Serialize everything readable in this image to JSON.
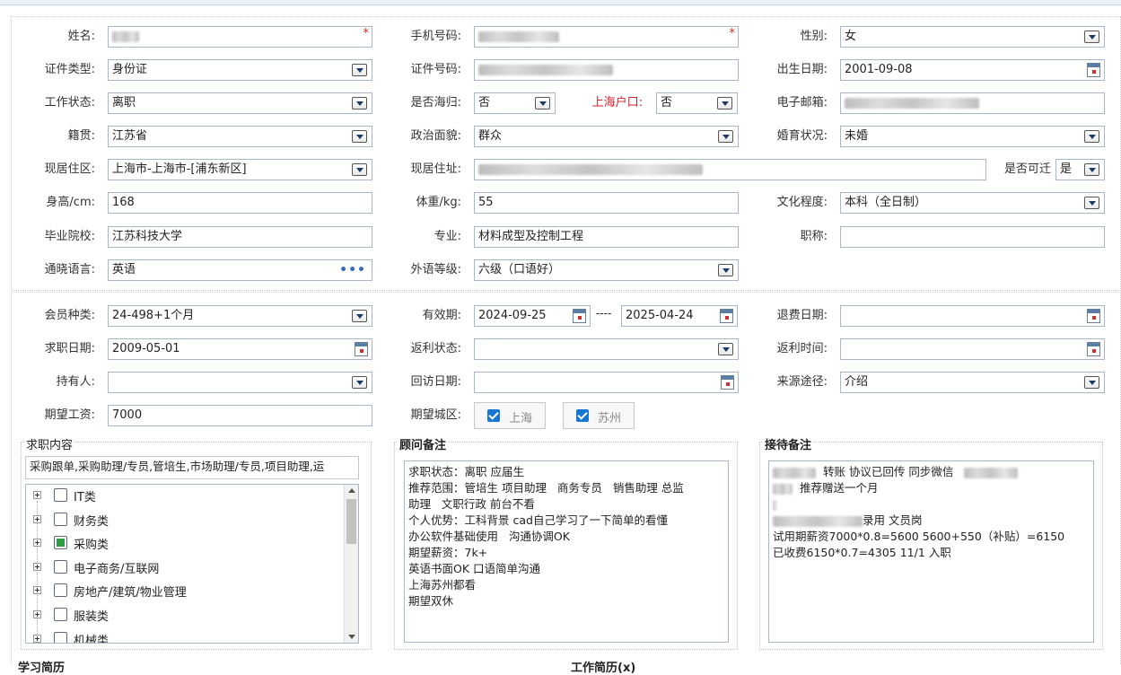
{
  "form": {
    "name": {
      "label": "姓名:",
      "req": "*"
    },
    "phone": {
      "label": "手机号码:",
      "req": "*"
    },
    "gender": {
      "label": "性别:",
      "value": "女"
    },
    "id_type": {
      "label": "证件类型:",
      "value": "身份证"
    },
    "id_no": {
      "label": "证件号码:"
    },
    "birth": {
      "label": "出生日期:",
      "value": "2001-09-08"
    },
    "work_status": {
      "label": "工作状态:",
      "value": "离职"
    },
    "overseas": {
      "label": "是否海归:",
      "value": "否"
    },
    "sh_hukou": {
      "label": "上海户口:",
      "value": "否"
    },
    "email": {
      "label": "电子邮箱:"
    },
    "native": {
      "label": "籍贯:",
      "value": "江苏省"
    },
    "political": {
      "label": "政治面貌:",
      "value": "群众"
    },
    "marital": {
      "label": "婚育状况:",
      "value": "未婚"
    },
    "residence_area": {
      "label": "现居住区:",
      "value": "上海市-上海市-[浦东新区]"
    },
    "residence_addr": {
      "label": "现居住址:"
    },
    "relocate": {
      "label": "是否可迁",
      "value": "是"
    },
    "height": {
      "label": "身高/cm:",
      "value": "168"
    },
    "weight": {
      "label": "体重/kg:",
      "value": "55"
    },
    "education": {
      "label": "文化程度:",
      "value": "本科（全日制）"
    },
    "school": {
      "label": "毕业院校:",
      "value": "江苏科技大学"
    },
    "major": {
      "label": "专业:",
      "value": "材料成型及控制工程"
    },
    "title": {
      "label": "职称:",
      "value": ""
    },
    "language": {
      "label": "通晓语言:",
      "value": "英语",
      "more": "•••"
    },
    "lang_level": {
      "label": "外语等级:",
      "value": "六级（口语好）"
    }
  },
  "member": {
    "type": {
      "label": "会员种类:",
      "value": "24-498+1个月"
    },
    "valid": {
      "label": "有效期:",
      "from": "2024-09-25",
      "sep": "----",
      "to": "2025-04-24"
    },
    "refund_date": {
      "label": "退费日期:",
      "value": ""
    },
    "job_date": {
      "label": "求职日期:",
      "value": "2009-05-01"
    },
    "rebate_status": {
      "label": "返利状态:",
      "value": ""
    },
    "rebate_time": {
      "label": "返利时间:",
      "value": ""
    },
    "holder": {
      "label": "持有人:",
      "value": ""
    },
    "visit_date": {
      "label": "回访日期:",
      "value": ""
    },
    "source": {
      "label": "来源途径:",
      "value": "介绍"
    },
    "salary": {
      "label": "期望工资:",
      "value": "7000"
    },
    "city": {
      "label": "期望城区:",
      "options": [
        "上海",
        "苏州"
      ]
    }
  },
  "job_content": {
    "legend": "求职内容",
    "selected": "采购跟单,采购助理/专员,管培生,市场助理/专员,项目助理,运",
    "tree": [
      "IT类",
      "财务类",
      "采购类",
      "电子商务/互联网",
      "房地产/建筑/物业管理",
      "服装类",
      "机械类"
    ],
    "checked": [
      false,
      false,
      true,
      false,
      false,
      false,
      false
    ]
  },
  "advisor": {
    "legend": "顾问备注",
    "text": "求职状态：离职 应届生\n推荐范围：管培生 项目助理   商务专员   销售助理 总监\n助理   文职行政 前台不看\n个人优势：工科背景 cad自己学习了一下简单的看懂\n办公软件基础使用   沟通协调OK\n期望薪资：7k+\n英语书面OK 口语简单沟通\n上海苏州都看\n期望双休"
  },
  "reception": {
    "legend": "接待备注",
    "line1": "转账  协议已回传    同步微信",
    "line2": "推荐赠送一个月",
    "line3": "录用 文员岗",
    "line4": "试用期薪资7000*0.8=5600 5600+550（补贴）=6150",
    "line5": "已收费6150*0.7=4305    11/1 入职"
  },
  "footer": {
    "study": "学习简历",
    "work": "工作简历(x)"
  },
  "colors": {
    "required": "#e02020",
    "label_red": "#d0202a",
    "check_blue": "#1976d2",
    "tree_check": "#2ea043"
  }
}
